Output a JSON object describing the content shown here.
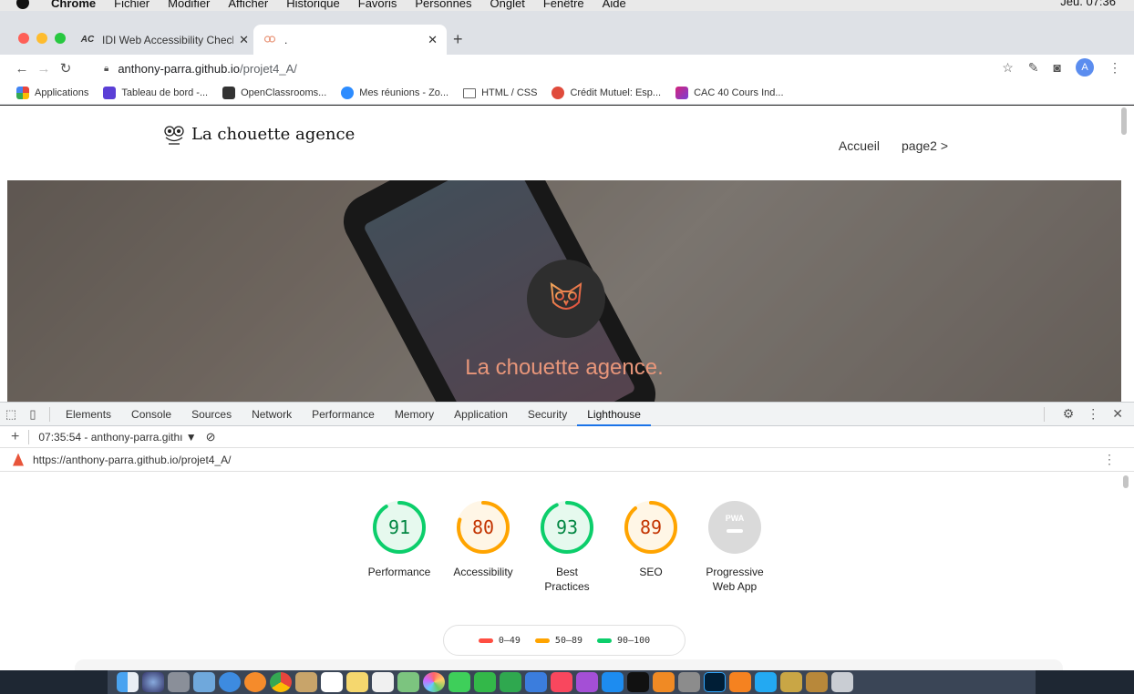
{
  "menubar": {
    "app": "Chrome",
    "items": [
      "Fichier",
      "Modifier",
      "Afficher",
      "Historique",
      "Favoris",
      "Personnes",
      "Onglet",
      "Fenêtre",
      "Aide"
    ],
    "clock": "Jeu. 07:36"
  },
  "tabs": [
    {
      "favicon": "AC",
      "title": "IDI Web Accessibility Checker"
    },
    {
      "favicon": "owl-favicon",
      "title": "."
    }
  ],
  "omnibox": {
    "host": "anthony-parra.github.io",
    "path": "/projet4_A/"
  },
  "profile_initial": "A",
  "bookmarks": [
    {
      "label": "Applications",
      "color": "#e8453c"
    },
    {
      "label": "Tableau de bord -...",
      "color": "#5b3fd6"
    },
    {
      "label": "OpenClassrooms...",
      "color": "#333333"
    },
    {
      "label": "Mes réunions - Zo...",
      "color": "#2d8cff"
    },
    {
      "label": "HTML / CSS",
      "color": "#666666"
    },
    {
      "label": "Crédit Mutuel: Esp...",
      "color": "#e04b3c"
    },
    {
      "label": "CAC 40 Cours Ind...",
      "color": "#d4237a"
    }
  ],
  "site": {
    "brand": "La chouette agence",
    "nav": [
      "Accueil",
      "page2 >"
    ],
    "tagline": "La chouette agence."
  },
  "devtools": {
    "tabs": [
      "Elements",
      "Console",
      "Sources",
      "Network",
      "Performance",
      "Memory",
      "Application",
      "Security",
      "Lighthouse"
    ],
    "active_tab": "Lighthouse",
    "report_selector": "07:35:54 - anthony-parra.githı ▼",
    "report_url": "https://anthony-parra.github.io/projet4_A/"
  },
  "scores": [
    {
      "value": "91",
      "score": 0.91,
      "label": "Performance",
      "color": "#0cce6b",
      "text_color": "#018642",
      "bg": "#e6f9ee"
    },
    {
      "value": "80",
      "score": 0.8,
      "label": "Accessibility",
      "color": "#ffa400",
      "text_color": "#c33300",
      "bg": "#fff6e6"
    },
    {
      "value": "93",
      "score": 0.93,
      "label": "Best Practices",
      "color": "#0cce6b",
      "text_color": "#018642",
      "bg": "#e6f9ee"
    },
    {
      "value": "89",
      "score": 0.89,
      "label": "SEO",
      "color": "#ffa400",
      "text_color": "#c33300",
      "bg": "#fff6e6"
    }
  ],
  "pwa": {
    "badge": "PWA",
    "label": "Progressive Web App"
  },
  "legend": [
    {
      "range": "0–49",
      "color": "#ff4e42"
    },
    {
      "range": "50–89",
      "color": "#ffa400"
    },
    {
      "range": "90–100",
      "color": "#0cce6b"
    }
  ]
}
